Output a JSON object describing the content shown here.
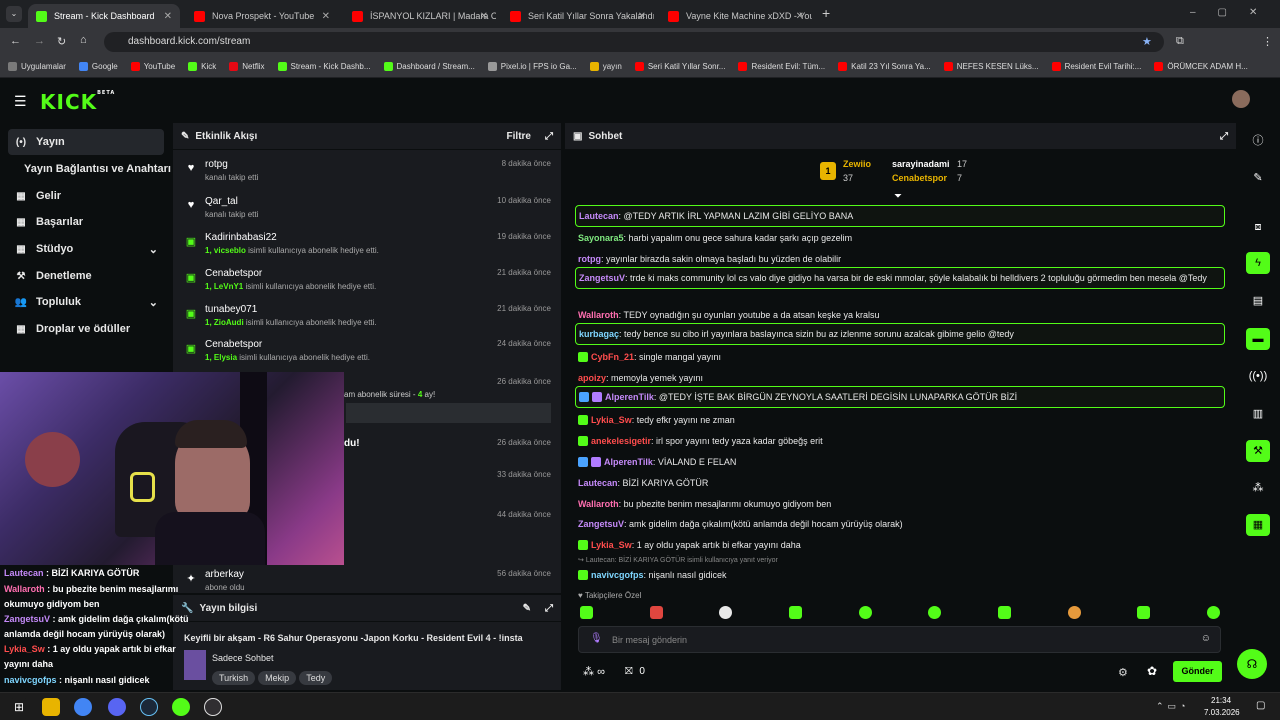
{
  "browser": {
    "tabs": [
      {
        "label": "Stream - Kick Dashboard",
        "active": true
      },
      {
        "label": "Nova Prospekt - YouTube"
      },
      {
        "label": "İSPANYOL KIZLARI | Madara Ok"
      },
      {
        "label": "Seri Katil Yıllar Sonra Yakalandı"
      },
      {
        "label": "Vayne Kite Machine xDXD - You"
      }
    ],
    "new_tab": "+",
    "url": "dashboard.kick.com/stream",
    "bookmarks": [
      "Uygulamalar",
      "Google",
      "YouTube",
      "Kick",
      "Netflix",
      "Stream - Kick Dashb...",
      "Dashboard / Stream...",
      "Pixel.io | FPS io Ga...",
      "yayın",
      "Seri Katil Yıllar Sonr...",
      "Resident Evil: Tüm...",
      "Katil 23 Yıl Sonra Ya...",
      "NEFES KESEN Lüks...",
      "Resident Evil Tarihi:...",
      "ÖRÜMCEK ADAM H..."
    ]
  },
  "kick": {
    "logo": "KICK",
    "beta": "BETA"
  },
  "sidebar": {
    "items": [
      {
        "label": "Yayın",
        "icon": "(•)"
      },
      {
        "label": "Yayın Bağlantısı ve Anahtarı",
        "icon": ""
      },
      {
        "label": "Gelir",
        "icon": "▦"
      },
      {
        "label": "Başarılar",
        "icon": "▦"
      },
      {
        "label": "Stüdyo",
        "icon": "▦"
      },
      {
        "label": "Denetleme",
        "icon": "⚒"
      },
      {
        "label": "Topluluk",
        "icon": "👥"
      },
      {
        "label": "Droplar ve ödüller",
        "icon": "▦"
      }
    ]
  },
  "activity": {
    "title": "Etkinlik Akışı",
    "filter": "Filtre",
    "items": [
      {
        "name": "rotpg",
        "desc": "kanalı takip etti",
        "time": "8 dakika önce",
        "icon": "♥",
        "gift": ""
      },
      {
        "name": "Qar_tal",
        "desc": "kanalı takip etti",
        "time": "10 dakika önce",
        "icon": "♥",
        "gift": ""
      },
      {
        "name": "Kadirinbabasi22",
        "gift": "1, vicseblo",
        "desc": "isimli kullanıcıya abonelik hediye etti.",
        "time": "19 dakika önce",
        "icon": "▣"
      },
      {
        "name": "Cenabetspor",
        "gift": "1, LeVnY1",
        "desc": "isimli kullanıcıya abonelik hediye etti.",
        "time": "21 dakika önce",
        "icon": "▣"
      },
      {
        "name": "tunabey071",
        "gift": "1, ZioAudi",
        "desc": "isimli kullanıcıya abonelik hediye etti.",
        "time": "21 dakika önce",
        "icon": "▣"
      },
      {
        "name": "Cenabetspor",
        "gift": "1, Elysia",
        "desc": "isimli kullanıcıya abonelik hediye etti.",
        "time": "24 dakika önce",
        "icon": "▣"
      }
    ],
    "partial": [
      {
        "text": "am abonelik süresi - ",
        "months": "4",
        "suffix": " ay!",
        "time": "26 dakika önce"
      },
      {
        "text": "du!",
        "time": "26 dakika önce"
      },
      {
        "text": "",
        "time": "33 dakika önce"
      },
      {
        "text": "",
        "time": "44 dakika önce"
      }
    ],
    "last": {
      "name": "arberkay",
      "desc": "abone oldu",
      "time": "56 dakika önce"
    }
  },
  "stream_info": {
    "title": "Yayın bilgisi",
    "stream_title": "Keyifli bir akşam - R6 Sahur Operasyonu -Japon Korku - Resident Evil 4 - !insta",
    "category": "Sadece Sohbet",
    "tags": [
      "Turkish",
      "Mekip",
      "Tedy"
    ]
  },
  "overlay_chat": [
    {
      "user": "Lautecan",
      "text": " : BİZİ KARIYA GÖTÜR",
      "color": "#c58af9"
    },
    {
      "user": "Wallaroth",
      "text": " : bu pbezite benim mesajlarımı okumuyo gidiyom ben",
      "color": "#ff6fb0"
    },
    {
      "user": "ZangetsuV",
      "text": " : amk gidelim dağa çıkalım(kötü anlamda değil hocam yürüyüş olarak)",
      "color": "#c58af9"
    },
    {
      "user": "Lykia_Sw",
      "text": " : 1 ay oldu yapak artık bi efkar yayını daha",
      "color": "#ff4d4d"
    },
    {
      "user": "navivcgofps",
      "text": " : nişanlı nasıl gidicek",
      "color": "#7fd6ff"
    }
  ],
  "chat": {
    "title": "Sohbet",
    "top": [
      {
        "rank": "1",
        "name": "Zewiio",
        "count": "37"
      },
      {
        "name": "sarayinadami",
        "count": "17"
      },
      {
        "name": "Cenabetspor",
        "count": "7"
      }
    ],
    "messages": [
      {
        "user": "Lautecan",
        "color": "#c58af9",
        "text": ": @TEDY ARTIK İRL YAPMAN LAZIM GİBİ GELİYO BANA",
        "hl": true
      },
      {
        "user": "Sayonara5",
        "color": "#7fe87f",
        "text": ": harbi yapalım onu gece sahura kadar şarkı açıp gezelim"
      },
      {
        "user": "rotpg",
        "color": "#c58af9",
        "text": ": yayınlar birazda sakin olmaya başladı bu yüzden de olabilir"
      },
      {
        "user": "ZangetsuV",
        "color": "#c58af9",
        "text": ": trde ki maks community lol cs valo diye gidiyo ha varsa bir de eski mmolar, şöyle kalabalık bi helldivers 2 topluluğu görmedim ben mesela @Tedy",
        "hl": true
      },
      {
        "user": "Wallaroth",
        "color": "#ff6fb0",
        "text": ": TEDY oynadığın şu oyunları youtube a da atsan keşke ya kralsu"
      },
      {
        "user": "kurbagaç",
        "color": "#7fd6ff",
        "text": ": tedy bence su cibo irl yayınlara baslayınca sizin bu az izlenme sorunu azalcak gibime gelio @tedy",
        "hl": true
      },
      {
        "user": "CybFn_21",
        "color": "#ff4d4d",
        "text": ": single mangal yayını"
      },
      {
        "user": "apoizy",
        "color": "#ff4d4d",
        "text": ": memoyla yemek yayını"
      },
      {
        "user": "AlperenTilk",
        "color": "#c58af9",
        "text": ": @TEDY İŞTE BAK BİRGÜN ZEYNOYLA SAATLERİ DEGİSİN LUNAPARKA GÖTÜR BİZİ",
        "hl": true
      },
      {
        "user": "Lykia_Sw",
        "color": "#ff4d4d",
        "text": ": tedy efkr yayını ne zman"
      },
      {
        "user": "anekelesigetir",
        "color": "#ff4d4d",
        "text": ": irl spor yayını tedy yaza kadar göbeğş erit"
      },
      {
        "user": "AlperenTilk",
        "color": "#c58af9",
        "text": ": VİALAND E FELAN"
      },
      {
        "user": "Lautecan",
        "color": "#c58af9",
        "text": ": BİZİ KARIYA GÖTÜR"
      },
      {
        "user": "Wallaroth",
        "color": "#ff6fb0",
        "text": ": bu pbezite benim mesajlarımı okumuyo gidiyom ben"
      },
      {
        "user": "ZangetsuV",
        "color": "#c58af9",
        "text": ": amk gidelim dağa çıkalım(kötü anlamda değil hocam yürüyüş olarak)"
      },
      {
        "user": "Lykia_Sw",
        "color": "#ff4d4d",
        "text": ": 1 ay oldu yapak artık bi efkar yayını daha"
      }
    ],
    "reply_note": "Lautecan: BİZİ KARIYA GÖTÜR isimli kullanıcıya yanıt veriyor",
    "reply_user": "navivcgofps",
    "reply_text": ": nişanlı nasıl gidicek",
    "emote_label": "Takipçilere Özel",
    "input_placeholder": "Bir mesaj gönderin",
    "points": "∞",
    "count": "0",
    "send": "Gönder"
  },
  "taskbar": {
    "time": "21:34",
    "date": "7.03.2026"
  },
  "colors": {
    "accent": "#53fc18",
    "bg": "#0b0e0f",
    "panel": "#191b1f"
  }
}
